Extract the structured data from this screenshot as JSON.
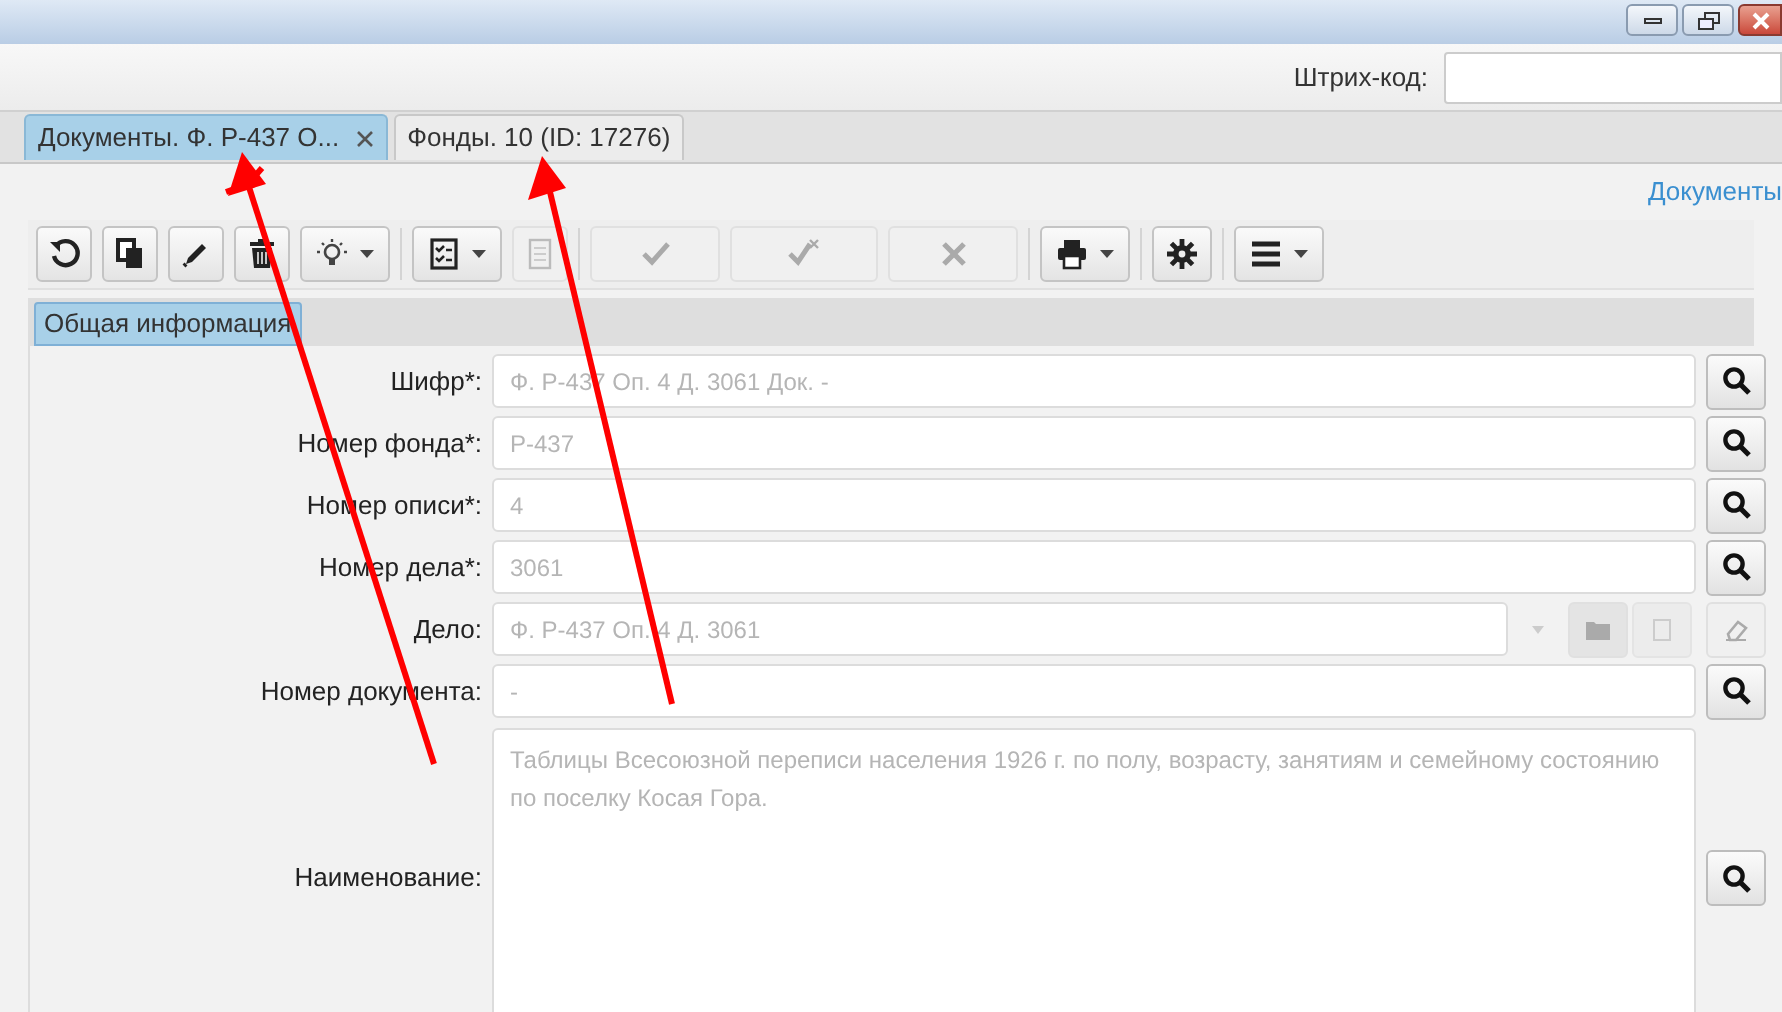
{
  "barcode": {
    "label": "Штрих-код:"
  },
  "tabs": [
    {
      "label": "Документы. Ф. Р-437  О...",
      "selected": true,
      "closable": true
    },
    {
      "label": "Фонды. 10 (ID: 17276)",
      "selected": false,
      "closable": false
    }
  ],
  "breadcrumb_link": "Документы",
  "toolbar": [
    {
      "disabled": false,
      "dropdown": false
    },
    {
      "disabled": false,
      "dropdown": false
    },
    {
      "disabled": false,
      "dropdown": false
    },
    {
      "disabled": false,
      "dropdown": false
    },
    {
      "disabled": false,
      "dropdown": true
    },
    {
      "disabled": false,
      "dropdown": true
    },
    {
      "disabled": true,
      "dropdown": false
    },
    {
      "disabled": true,
      "dropdown": false
    },
    {
      "disabled": true,
      "dropdown": false
    },
    {
      "disabled": true,
      "dropdown": false
    },
    {
      "disabled": false,
      "dropdown": true
    },
    {
      "disabled": false,
      "dropdown": false
    },
    {
      "disabled": false,
      "dropdown": true
    }
  ],
  "section_tabs": [
    {
      "label": "Общая информация",
      "selected": true
    }
  ],
  "fields": [
    {
      "kind": "lookup",
      "label": "Шифр*:",
      "value": "Ф. Р-437 Оп. 4 Д. 3061 Док. -"
    },
    {
      "kind": "lookup",
      "label": "Номер фонда*:",
      "value": "Р-437"
    },
    {
      "kind": "lookup",
      "label": "Номер описи*:",
      "value": "4"
    },
    {
      "kind": "lookup",
      "label": "Номер дела*:",
      "value": "3061"
    },
    {
      "kind": "combo",
      "label": "Дело:",
      "value": "Ф. Р-437 Оп. 4 Д. 3061"
    },
    {
      "kind": "lookup",
      "label": "Номер документа:",
      "value": "-"
    },
    {
      "kind": "textarea",
      "label": "Наименование:",
      "value": "Таблицы Всесоюзной переписи населения 1926 г. по полу, возрасту, занятиям и семейному состоянию по поселку Косая Гора."
    }
  ]
}
